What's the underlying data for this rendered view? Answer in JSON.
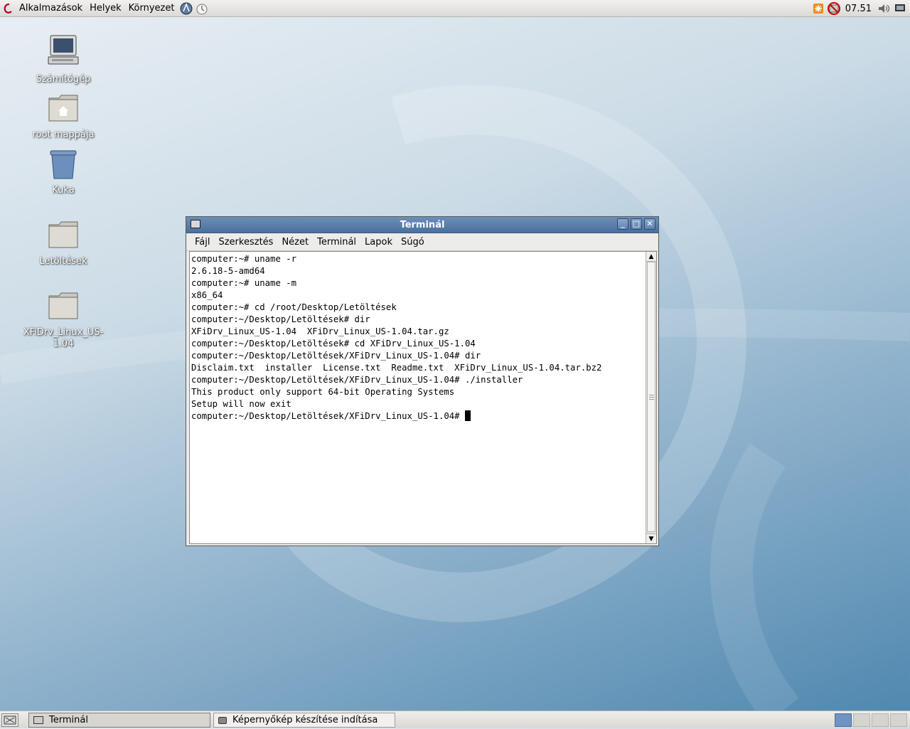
{
  "top_panel": {
    "menus": [
      "Alkalmazások",
      "Helyek",
      "Környezet"
    ],
    "clock": "07.51"
  },
  "desktop_icons": [
    {
      "label": "Számítógép",
      "icon": "computer-icon"
    },
    {
      "label": "root mappája",
      "icon": "home-folder-icon"
    },
    {
      "label": "Kuka",
      "icon": "trash-icon"
    },
    {
      "label": "Letöltések",
      "icon": "folder-icon"
    },
    {
      "label": "XFiDrv_Linux_US-1.04",
      "icon": "folder-icon"
    }
  ],
  "window": {
    "title": "Terminál",
    "menu": [
      "Fájl",
      "Szerkesztés",
      "Nézet",
      "Terminál",
      "Lapok",
      "Súgó"
    ],
    "lines": [
      "computer:~# uname -r",
      "2.6.18-5-amd64",
      "computer:~# uname -m",
      "x86_64",
      "computer:~# cd /root/Desktop/Letöltések",
      "computer:~/Desktop/Letöltések# dir",
      "XFiDrv_Linux_US-1.04  XFiDrv_Linux_US-1.04.tar.gz",
      "computer:~/Desktop/Letöltések# cd XFiDrv_Linux_US-1.04",
      "computer:~/Desktop/Letöltések/XFiDrv_Linux_US-1.04# dir",
      "Disclaim.txt  installer  License.txt  Readme.txt  XFiDrv_Linux_US-1.04.tar.bz2",
      "computer:~/Desktop/Letöltések/XFiDrv_Linux_US-1.04# ./installer",
      "This product only support 64-bit Operating Systems",
      "Setup will now exit"
    ],
    "prompt": "computer:~/Desktop/Letöltések/XFiDrv_Linux_US-1.04# "
  },
  "taskbar": {
    "tasks": [
      "Terminál",
      "Képernyőkép készítése indítása"
    ],
    "workspaces": 4,
    "active_workspace": 1
  }
}
